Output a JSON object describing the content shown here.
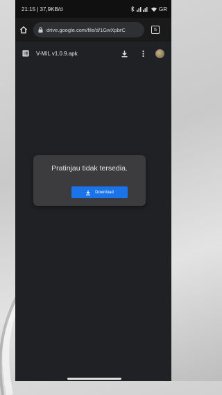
{
  "status_bar": {
    "time_speed": "21:15 | 37,9KB/d",
    "right_text": "GR"
  },
  "browser": {
    "url": "drive.google.com/file/d/1GwXpbrC",
    "tab_count": "5"
  },
  "drive": {
    "file_name": "V-MIL v1.0.9.apk"
  },
  "preview": {
    "message": "Pratinjau tidak tersedia.",
    "download_label": "Download"
  },
  "colors": {
    "download_button": "#1a73e8",
    "background": "#202124"
  },
  "icons": [
    "home-icon",
    "lock-icon",
    "tabs-icon",
    "file-list-icon",
    "download-icon",
    "more-vert-icon",
    "avatar"
  ]
}
